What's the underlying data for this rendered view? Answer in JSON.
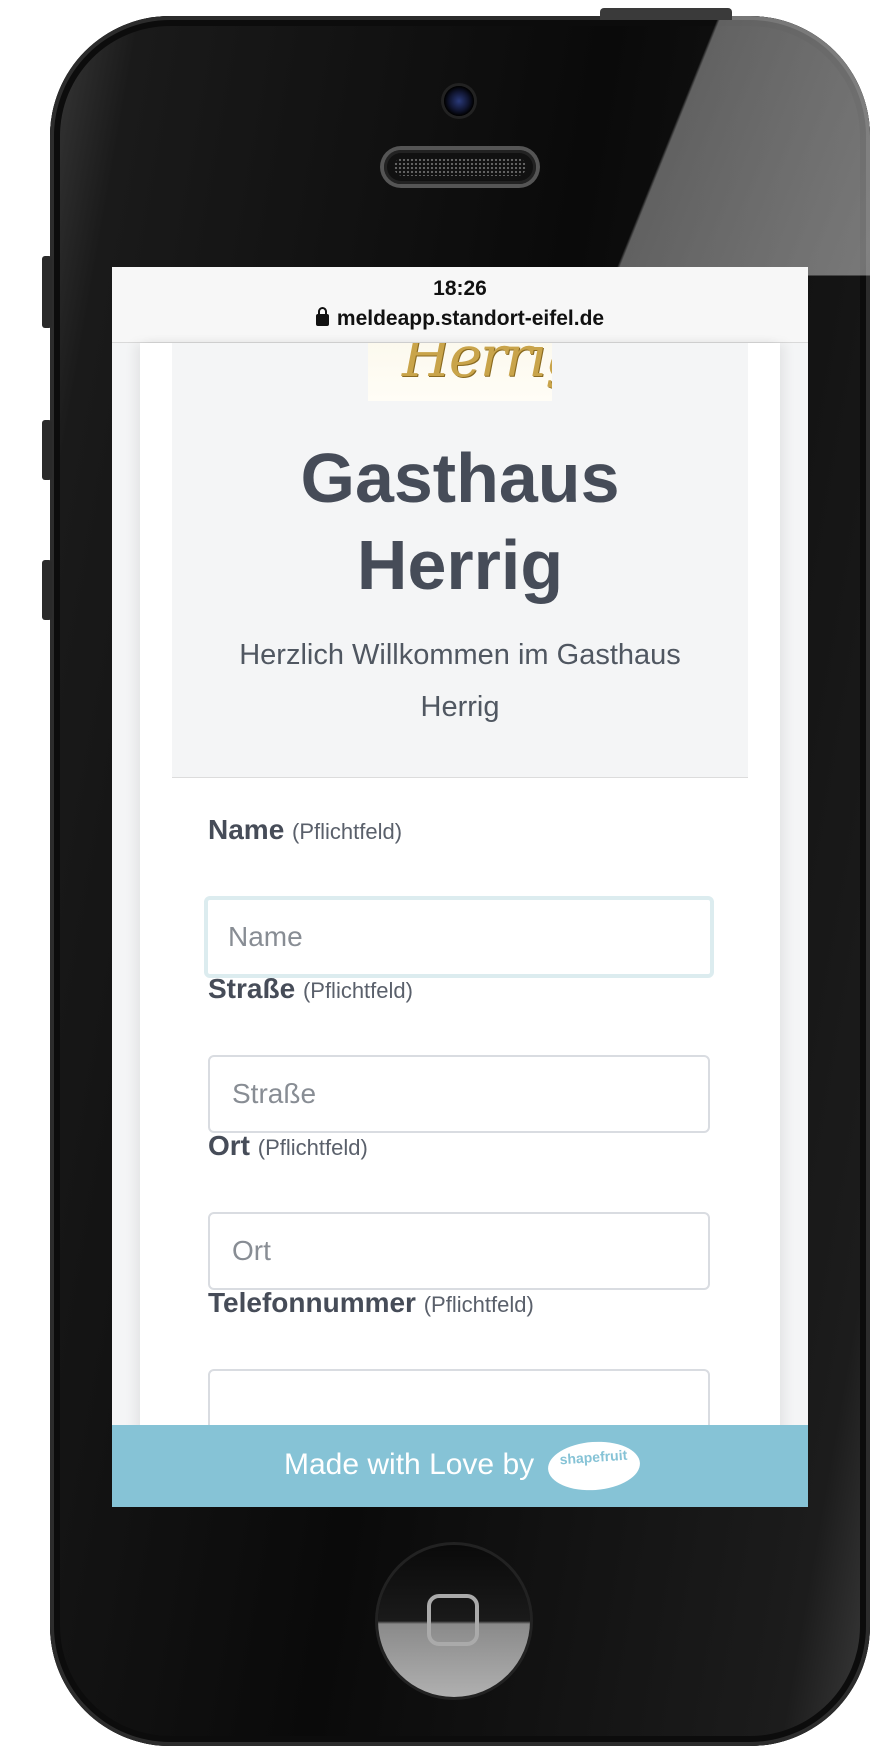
{
  "browser": {
    "time": "18:26",
    "url": "meldeapp.standort-eifel.de"
  },
  "hero": {
    "logo_text": "Herrig",
    "title_line1": "Gasthaus",
    "title_line2": "Herrig",
    "subtitle_line1": "Herzlich Willkommen im Gasthaus",
    "subtitle_line2": "Herrig"
  },
  "form": {
    "fields": [
      {
        "label": "Name",
        "required": "(Pflichtfeld)",
        "placeholder": "Name",
        "value": ""
      },
      {
        "label": "Straße",
        "required": "(Pflichtfeld)",
        "placeholder": "Straße",
        "value": ""
      },
      {
        "label": "Ort",
        "required": "(Pflichtfeld)",
        "placeholder": "Ort",
        "value": ""
      },
      {
        "label": "Telefonnummer",
        "required": "(Pflichtfeld)",
        "placeholder": "",
        "value": ""
      }
    ],
    "focused_field": "Name"
  },
  "footer": {
    "text": "Made with Love by",
    "brand": "shapefruit"
  },
  "colors": {
    "footer_bg": "#86c3d6",
    "heading": "#464c58",
    "focus_ring": "#dcecef"
  }
}
